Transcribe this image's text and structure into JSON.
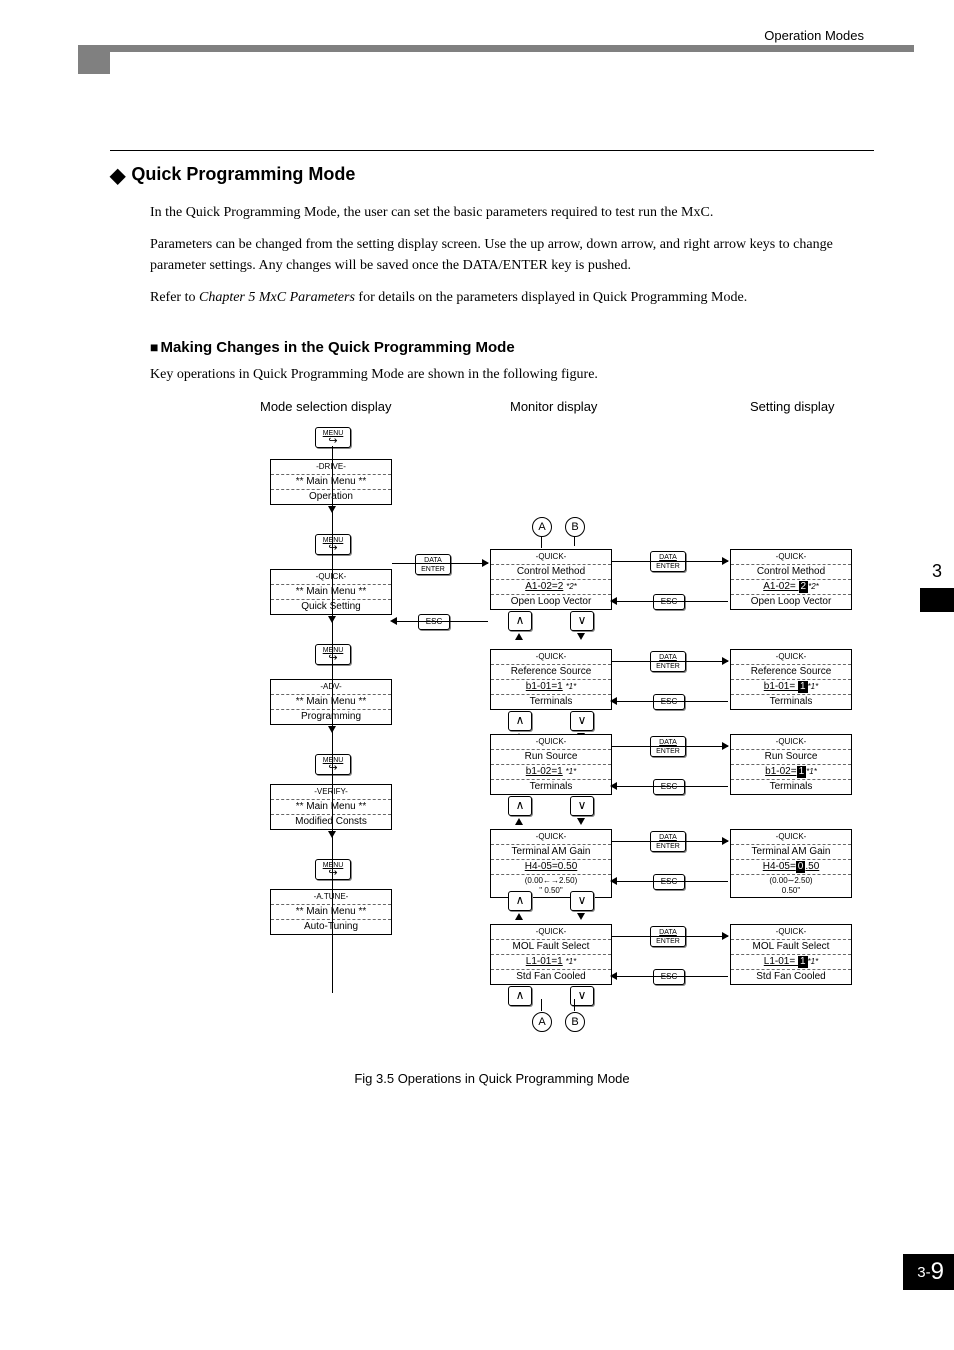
{
  "header": {
    "section": "Operation Modes"
  },
  "side_tab": {
    "chapter": "3"
  },
  "page_number": {
    "prefix": "3-",
    "num": "9"
  },
  "title": "Quick Programming Mode",
  "paragraphs": {
    "p1": "In the Quick Programming Mode, the user can set the basic parameters required to test run the MxC.",
    "p2": "Parameters can be changed from the setting display screen. Use the up arrow, down arrow, and right arrow keys to change parameter settings. Any changes will be saved once the DATA/ENTER key is pushed.",
    "p3a": "Refer to ",
    "p3i": "Chapter 5 MxC Parameters",
    "p3b": " for details on the parameters displayed in Quick Programming Mode."
  },
  "subheading": "Making Changes in the Quick Programming Mode",
  "subpara": "Key operations in Quick Programming Mode are shown in the following figure.",
  "figure_caption": "Fig 3.5  Operations in Quick Programming Mode",
  "columns": {
    "c1": "Mode selection display",
    "c2": "Monitor display",
    "c3": "Setting display"
  },
  "keys": {
    "menu_top": "MENU",
    "menu_arrow": "↪",
    "data_top": "DATA",
    "data_bottom": "ENTER",
    "esc": "ESC",
    "up": "∧",
    "down": "∨"
  },
  "letters": {
    "A": "A",
    "B": "B"
  },
  "mode_menus": [
    {
      "tag": "-DRIVE-",
      "line": "** Main Menu **",
      "label": "Operation"
    },
    {
      "tag": "-QUICK-",
      "line": "** Main Menu **",
      "label": "Quick Setting"
    },
    {
      "tag": "-ADV-",
      "line": "** Main Menu **",
      "label": "Programming"
    },
    {
      "tag": "-VERIFY-",
      "line": "** Main Menu **",
      "label": "Modified Consts"
    },
    {
      "tag": "-A.TUNE-",
      "line": "** Main Menu **",
      "label": "Auto-Tuning"
    }
  ],
  "monitor": [
    {
      "tag": "-QUICK-",
      "title": "Control Method",
      "l2": "A1-02=2",
      "suffix": "*2*",
      "l3": "Open Loop Vector"
    },
    {
      "tag": "-QUICK-",
      "title": "Reference Source",
      "l2": "b1-01=1",
      "suffix": "*1*",
      "l3": "Terminals"
    },
    {
      "tag": "-QUICK-",
      "title": "Run Source",
      "l2": "b1-02=1",
      "suffix": "*1*",
      "l3": "Terminals"
    },
    {
      "tag": "-QUICK-",
      "title": "Terminal AM Gain",
      "l2": "H4-05=0.50",
      "suffix": "",
      "l3a": "(0.00←→2.50)",
      "l3b": "\" 0.50\""
    },
    {
      "tag": "-QUICK-",
      "title": "MOL Fault Select",
      "l2": "L1-01=1",
      "suffix": "*1*",
      "l3": "Std Fan Cooled"
    }
  ],
  "setting": [
    {
      "tag": "-QUICK-",
      "title": "Control Method",
      "pre": "A1-02= ",
      "hl": "2",
      "post": "",
      "suffix": "*2*",
      "l3": "Open Loop Vector"
    },
    {
      "tag": "-QUICK-",
      "title": "Reference Source",
      "pre": "b1-01= ",
      "hl": "1",
      "post": "",
      "suffix": "*1*",
      "l3": "Terminals"
    },
    {
      "tag": "-QUICK-",
      "title": "Run Source",
      "pre": "b1-02=",
      "hl": "1",
      "post": "",
      "suffix": "*1*",
      "l3": "Terminals"
    },
    {
      "tag": "-QUICK-",
      "title": "Terminal AM Gain",
      "pre": "H4-05=",
      "hl": "0",
      "post": ".50",
      "suffix": "",
      "l3a": "(0.00∼2.50)",
      "l3b": "0.50\""
    },
    {
      "tag": "-QUICK-",
      "title": "MOL Fault Select",
      "pre": "L1-01= ",
      "hl": "1",
      "post": "",
      "suffix": "*1*",
      "l3": "Std Fan Cooled"
    }
  ]
}
